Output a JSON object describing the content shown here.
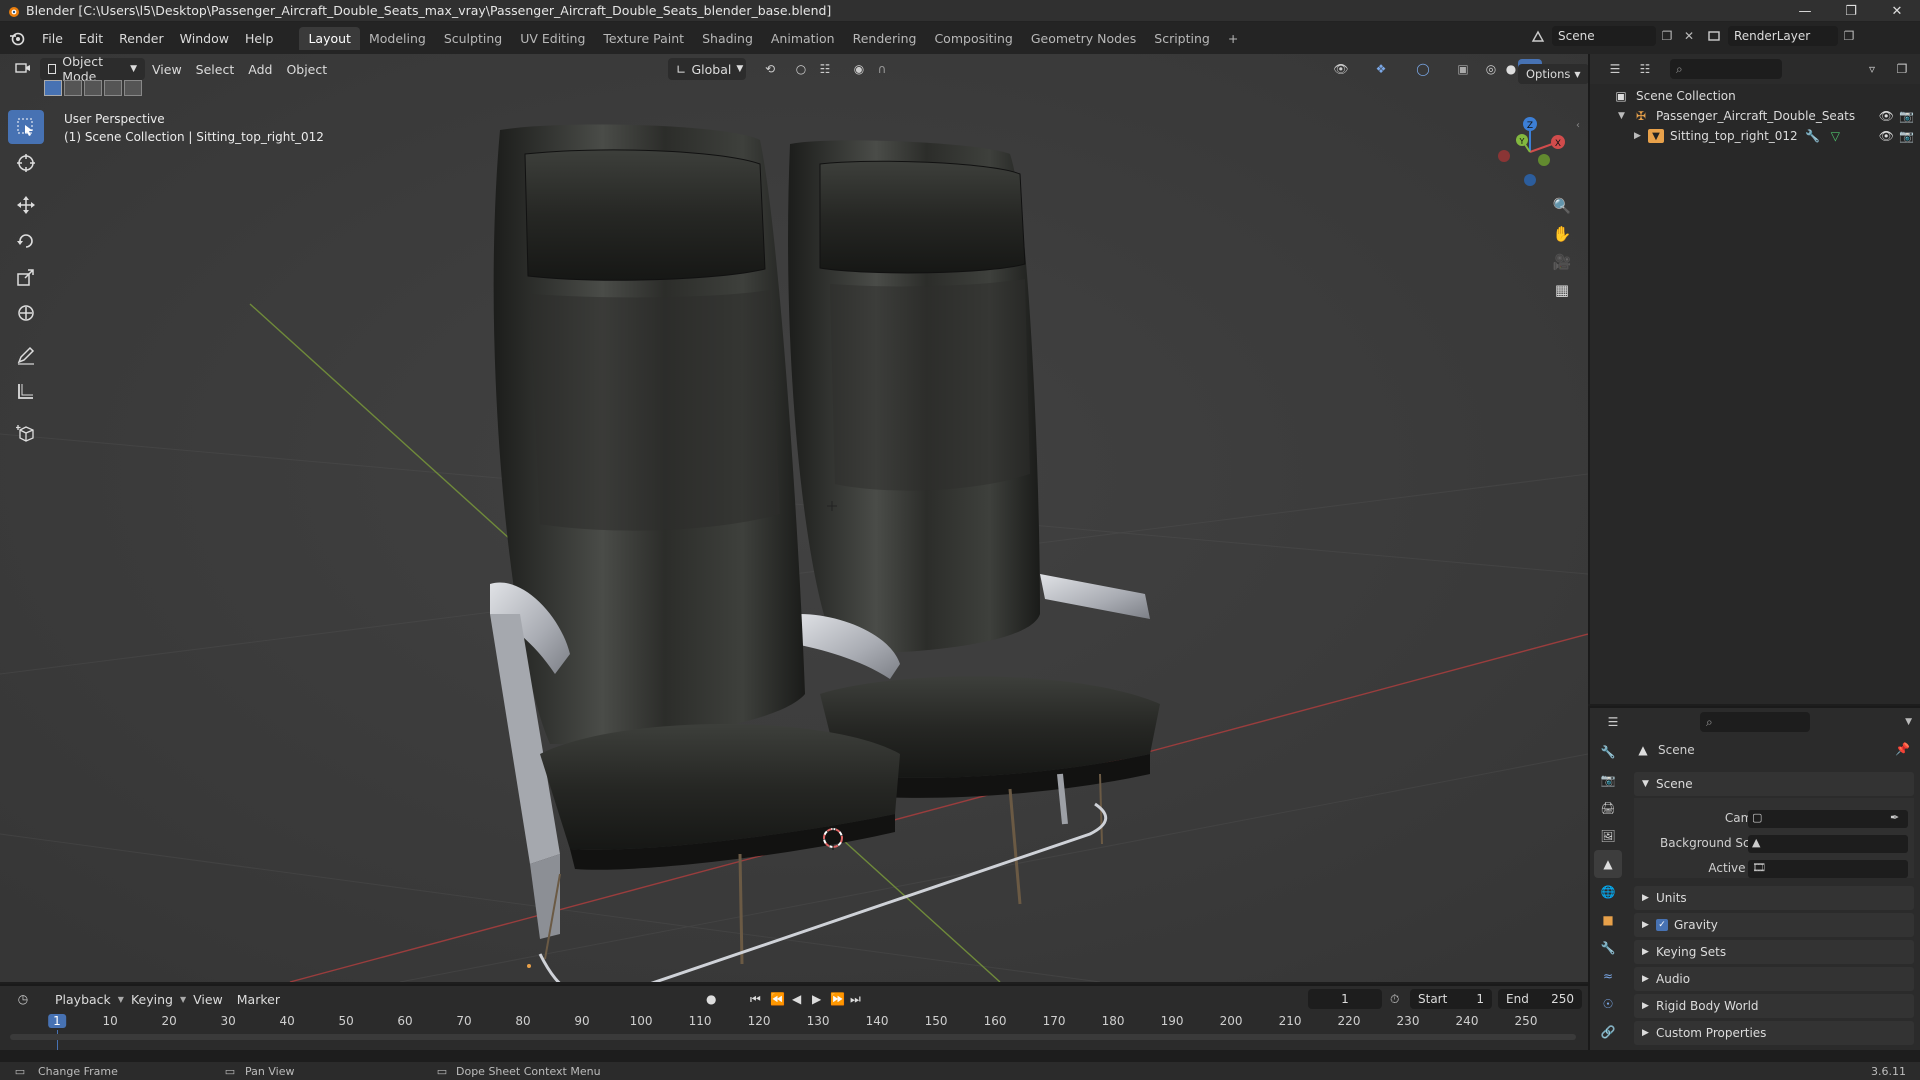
{
  "window": {
    "title": "Blender [C:\\Users\\l5\\Desktop\\Passenger_Aircraft_Double_Seats_max_vray\\Passenger_Aircraft_Double_Seats_blender_base.blend]"
  },
  "menus": [
    "File",
    "Edit",
    "Render",
    "Window",
    "Help"
  ],
  "workspaces": [
    "Layout",
    "Modeling",
    "Sculpting",
    "UV Editing",
    "Texture Paint",
    "Shading",
    "Animation",
    "Rendering",
    "Compositing",
    "Geometry Nodes",
    "Scripting"
  ],
  "scene_selector": {
    "scene": "Scene",
    "view_layer": "RenderLayer"
  },
  "viewport": {
    "mode": "Object Mode",
    "menus": [
      "View",
      "Select",
      "Add",
      "Object"
    ],
    "transform_orientation": "Global",
    "options_label": "Options",
    "info_line1": "User Perspective",
    "info_line2": "(1) Scene Collection | Sitting_top_right_012",
    "gizmo_axes": {
      "x": "X",
      "y": "Y",
      "z": "Z"
    }
  },
  "outliner": {
    "root": "Scene Collection",
    "items": [
      {
        "label": "Passenger_Aircraft_Double_Seats"
      },
      {
        "label": "Sitting_top_right_012"
      }
    ]
  },
  "properties": {
    "header": "Scene",
    "panel_scene": "Scene",
    "camera_label": "Camera",
    "background_scene_label": "Background Scene",
    "active_clip_label": "Active Clip",
    "panels": [
      "Units",
      "Gravity",
      "Keying Sets",
      "Audio",
      "Rigid Body World",
      "Custom Properties"
    ],
    "gravity_checked": true
  },
  "timeline": {
    "menus": [
      "Playback",
      "Keying",
      "View",
      "Marker"
    ],
    "current_frame": "1",
    "start_label": "Start",
    "start": "1",
    "end_label": "End",
    "end": "250",
    "ticks": [
      "1",
      "10",
      "20",
      "30",
      "40",
      "50",
      "60",
      "70",
      "80",
      "90",
      "100",
      "110",
      "120",
      "130",
      "140",
      "150",
      "160",
      "170",
      "180",
      "190",
      "200",
      "210",
      "220",
      "230",
      "240",
      "250"
    ]
  },
  "statusbar": {
    "left": "Change Frame",
    "middle": "Pan View",
    "right": "Dope Sheet Context Menu",
    "version": "3.6.11"
  },
  "colors": {
    "accent": "#4772b3",
    "axis_x": "#d14c4c",
    "axis_y": "#82b83f",
    "axis_z": "#3c7fd6",
    "active_frame": "#4772b3"
  }
}
